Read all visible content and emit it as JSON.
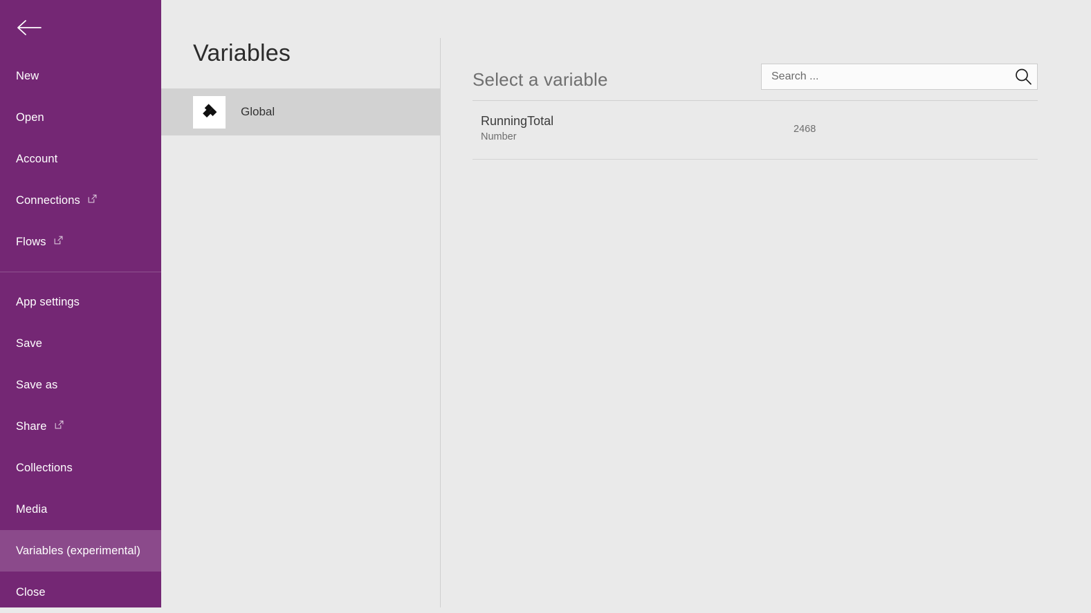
{
  "sidebar": {
    "back_icon": "back-arrow-icon",
    "items": [
      {
        "label": "New",
        "external": false,
        "selected": false,
        "divider_after": false
      },
      {
        "label": "Open",
        "external": false,
        "selected": false,
        "divider_after": false
      },
      {
        "label": "Account",
        "external": false,
        "selected": false,
        "divider_after": false
      },
      {
        "label": "Connections",
        "external": true,
        "selected": false,
        "divider_after": false
      },
      {
        "label": "Flows",
        "external": true,
        "selected": false,
        "divider_after": true
      },
      {
        "label": "App settings",
        "external": false,
        "selected": false,
        "divider_after": false
      },
      {
        "label": "Save",
        "external": false,
        "selected": false,
        "divider_after": false
      },
      {
        "label": "Save as",
        "external": false,
        "selected": false,
        "divider_after": false
      },
      {
        "label": "Share",
        "external": true,
        "selected": false,
        "divider_after": false
      },
      {
        "label": "Collections",
        "external": false,
        "selected": false,
        "divider_after": false
      },
      {
        "label": "Media",
        "external": false,
        "selected": false,
        "divider_after": false
      },
      {
        "label": "Variables (experimental)",
        "external": false,
        "selected": true,
        "divider_after": false
      },
      {
        "label": "Close",
        "external": false,
        "selected": false,
        "divider_after": false
      }
    ],
    "colors": {
      "background": "#742774",
      "selected": "#8b4a8b",
      "divider": "#8f538f",
      "text": "#ffffff"
    }
  },
  "panel": {
    "title": "Variables",
    "scopes": [
      {
        "label": "Global",
        "icon": "global-variables-diamonds-icon",
        "selected": true
      }
    ]
  },
  "main": {
    "heading": "Select a variable",
    "search": {
      "value": "",
      "placeholder": "Search ...",
      "icon": "search-icon"
    },
    "variables": [
      {
        "name": "RunningTotal",
        "type": "Number",
        "value": "2468"
      }
    ]
  },
  "colors": {
    "page_background": "#eaeaea",
    "scope_selected": "#d2d2d2",
    "rule": "#d0d0d0"
  }
}
